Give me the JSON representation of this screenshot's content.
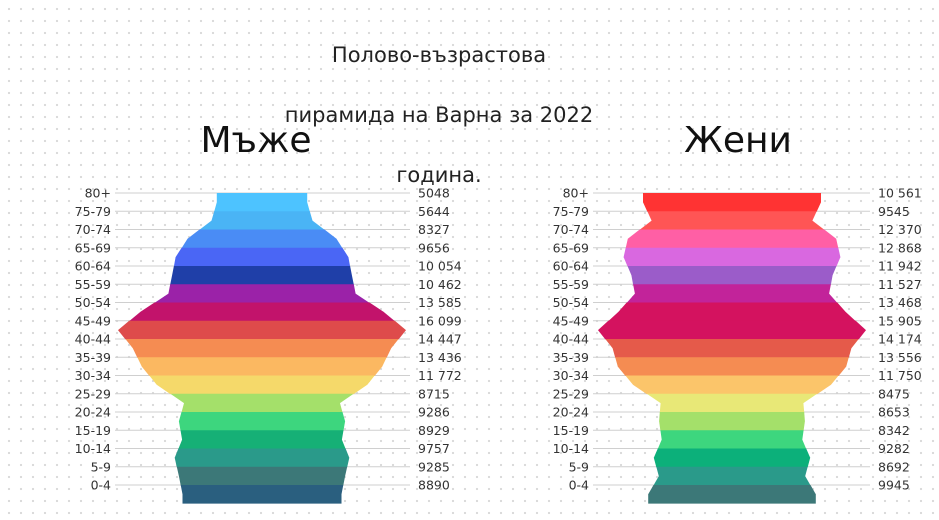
{
  "title_lines": [
    "Полово-възрастова",
    "пирамида на Варна за 2022",
    "година."
  ],
  "chart_data": [
    {
      "type": "bar",
      "title": "Мъже",
      "categories": [
        "80+",
        "75-79",
        "70-74",
        "65-69",
        "60-64",
        "55-59",
        "50-54",
        "45-49",
        "40-44",
        "35-39",
        "30-34",
        "25-29",
        "20-24",
        "15-19",
        "10-14",
        "5-9",
        "0-4"
      ],
      "values": [
        5048,
        5644,
        8327,
        9656,
        10054,
        10462,
        13585,
        16099,
        14447,
        13436,
        11772,
        8715,
        9286,
        8929,
        9757,
        9285,
        8890
      ],
      "value_labels": [
        "5048",
        "5644",
        "8327",
        "9656",
        "10 054",
        "10 462",
        "13 585",
        "16 099",
        "14 447",
        "13 436",
        "11 772",
        "8715",
        "9286",
        "8929",
        "9757",
        "9285",
        "8890"
      ],
      "colors": [
        "#4dc3ff",
        "#4ab4f5",
        "#4a8cf5",
        "#4a66f5",
        "#1f3fa8",
        "#9b22a8",
        "#c2136b",
        "#de4b4b",
        "#f58c52",
        "#fbb861",
        "#f5d96a",
        "#a4e06a",
        "#3dd67e",
        "#16b076",
        "#2a9a8a",
        "#3c7878",
        "#2a5f7f"
      ],
      "grid": true
    },
    {
      "type": "bar",
      "title": "Жени",
      "categories": [
        "80+",
        "75-79",
        "70-74",
        "65-69",
        "60-64",
        "55-59",
        "50-54",
        "45-49",
        "40-44",
        "35-39",
        "30-34",
        "25-29",
        "20-24",
        "15-19",
        "10-14",
        "5-9",
        "0-4"
      ],
      "values": [
        10561,
        9545,
        12370,
        12868,
        11942,
        11527,
        13468,
        15905,
        14174,
        13556,
        11750,
        8475,
        8653,
        8342,
        9282,
        8692,
        9945
      ],
      "value_labels": [
        "10 561",
        "9545",
        "12 370",
        "12 868",
        "11 942",
        "11 527",
        "13 468",
        "15 905",
        "14 174",
        "13 556",
        "11 750",
        "8475",
        "8653",
        "8342",
        "9282",
        "8692",
        "9945"
      ],
      "colors": [
        "#ff3333",
        "#ff5555",
        "#ff5fa5",
        "#d968e0",
        "#9b5cc9",
        "#c2239a",
        "#d4125f",
        "#d4125f",
        "#e55a4a",
        "#f58c52",
        "#fbc56a",
        "#e8e877",
        "#a4e06a",
        "#3dd67e",
        "#0cb07a",
        "#2a9a8a",
        "#3c7878"
      ],
      "grid": true
    }
  ]
}
